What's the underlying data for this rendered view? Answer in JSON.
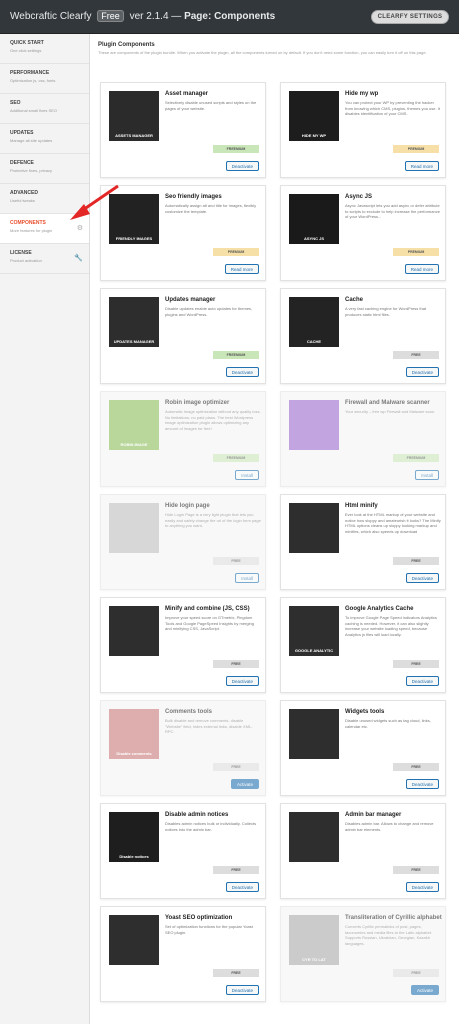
{
  "header": {
    "app_name": "Webcraftic Clearfy",
    "edition": "Free",
    "version": "ver 2.1.4 —",
    "page": "Page: Components",
    "settings_button": "CLEARFY SETTINGS"
  },
  "sidebar": {
    "items": [
      {
        "title": "QUICK START",
        "desc": "One click settings",
        "active": false
      },
      {
        "title": "PERFORMANCE",
        "desc": "Optimization js, css, fonts",
        "active": false
      },
      {
        "title": "SEO",
        "desc": "Additional small fixes SEO",
        "active": false
      },
      {
        "title": "UPDATES",
        "desc": "Manage all site updates",
        "active": false
      },
      {
        "title": "DEFENCE",
        "desc": "Protective fixes, privacy",
        "active": false
      },
      {
        "title": "ADVANCED",
        "desc": "Useful tweaks",
        "active": false
      },
      {
        "title": "COMPONENTS",
        "desc": "More features for plugin",
        "active": true
      },
      {
        "title": "LICENSE",
        "desc": "Product activation",
        "active": false
      }
    ]
  },
  "main": {
    "title": "Plugin Components",
    "desc": "These are components of the plugin bundle. When you activate the plugin, all the components turned on by default. If you don't need some function, you can easily turn it off on this page."
  },
  "cards": [
    {
      "name": "Asset manager",
      "desc": "Selectively disable unused scripts and styles on the pages of your website.",
      "badge": "FREEMIUM",
      "button": "Deactivate",
      "img_label": "ASSETS MANAGER",
      "dim": false
    },
    {
      "name": "Hide my wp",
      "desc": "You can protect your WP by preventing the hacker from knowing which CMS, plugins, themes you use. It disables identification of your CMS.",
      "badge": "PREMIUM",
      "button": "Read more",
      "img_label": "HIDE MY WP",
      "dim": false
    },
    {
      "name": "Seo friendly images",
      "desc": "Automatically assign alt and title for images, flexibly customize the template.",
      "badge": "PREMIUM",
      "button": "Read more",
      "img_label": "FRIENDLY IMAGES",
      "dim": false
    },
    {
      "name": "Async JS",
      "desc": "Async Javascript lets you add async or defer attribute to scripts to exclude to help increase the performance of your WordPress...",
      "badge": "PREMIUM",
      "button": "Read more",
      "img_label": "ASYNC JS",
      "dim": false
    },
    {
      "name": "Updates manager",
      "desc": "Disable updates enable auto updates for themes, plugins and WordPress.",
      "badge": "FREEMIUM",
      "button": "Deactivate",
      "img_label": "UPDATES MANAGER",
      "dim": false
    },
    {
      "name": "Cache",
      "desc": "A very fast caching engine for WordPress that produces static html files.",
      "badge": "FREE",
      "button": "Deactivate",
      "img_label": "CACHE",
      "dim": false
    },
    {
      "name": "Robin image optimizer",
      "desc": "Automatic image optimization without any quality loss. No limitations, no paid plans. The best Wordpress image optimization plugin allows optimizing any amount of images for free!",
      "badge": "FREEMIUM",
      "button": "Install",
      "img_label": "ROBIN IMAGE",
      "dim": true
    },
    {
      "name": "Firewall and Malware scanner",
      "desc": "Your security – free wp Firewall and Malware scan.",
      "badge": "FREEMIUM",
      "button": "Install",
      "img_label": "",
      "dim": true
    },
    {
      "name": "Hide login page",
      "desc": "Hide Login Page is a very light plugin that lets you easily and safely change the url of the login form page to anything you want.",
      "badge": "FREE",
      "button": "Install",
      "img_label": "",
      "dim": true
    },
    {
      "name": "Html minify",
      "desc": "Ever look at the HTML markup of your website and notice how sloppy and amateurish it looks? The Minify HTML options cleans up sloppy looking markup and minifies, which also speeds up download",
      "badge": "FREE",
      "button": "Deactivate",
      "img_label": "",
      "dim": false
    },
    {
      "name": "Minify and combine (JS, CSS)",
      "desc": "Improve your speed score on GTmetrix, Pingdom Tools and Google PageSpeed Insights by merging and minifying CSS, JavaScript.",
      "badge": "FREE",
      "button": "Deactivate",
      "img_label": "",
      "dim": false
    },
    {
      "name": "Google Analytics Cache",
      "desc": "To improve Google Page Speed indicators Analytics caching is needed. However, it can also slightly increase your website loading speed, because Analytics js files will load locally.",
      "badge": "FREE",
      "button": "Deactivate",
      "img_label": "GOOGLE ANALYTIC",
      "dim": false
    },
    {
      "name": "Comments tools",
      "desc": "Bulk disable and remove comments, disable \"Website\" field, hides external links, disable XML-RPC.",
      "badge": "FREE",
      "button": "Activate",
      "img_label": "Disable comments",
      "dim": true
    },
    {
      "name": "Widgets tools",
      "desc": "Disable unused widgets such as tag cloud, links, calendar etc.",
      "badge": "FREE",
      "button": "Deactivate",
      "img_label": "",
      "dim": false
    },
    {
      "name": "Disable admin notices",
      "desc": "Disables admin notices bulk or individually. Collects notices into the admin bar.",
      "badge": "FREE",
      "button": "Deactivate",
      "img_label": "Disable notices",
      "dim": false
    },
    {
      "name": "Admin bar manager",
      "desc": "Disables admin bar. Allows to change and remove admin bar elements.",
      "badge": "FREE",
      "button": "Deactivate",
      "img_label": "",
      "dim": false
    },
    {
      "name": "Yoast SEO optimization",
      "desc": "Set of optimization functions for the popular Yoast SEO plugin.",
      "badge": "FREE",
      "button": "Deactivate",
      "img_label": "",
      "dim": false
    },
    {
      "name": "Transliteration of Cyrillic alphabet",
      "desc": "Converts Cyrillic permalinks of post, pages, taxonomies and media files to the Latin alphabet. Supports Russian, Ukrainian, Georgian, Kazakh languages.",
      "badge": "FREE",
      "button": "Activate",
      "img_label": "CYR TO LAT",
      "dim": true
    }
  ],
  "colors": {
    "accent": "#e94e2d",
    "button": "#2271b1",
    "header_bg": "#32373c"
  }
}
